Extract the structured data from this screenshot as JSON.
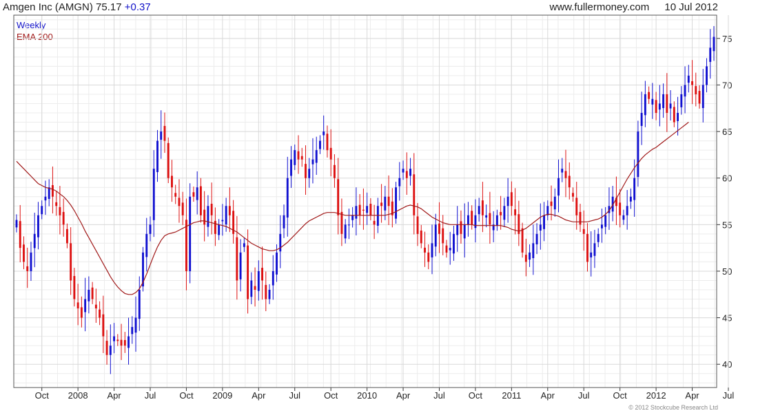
{
  "header": {
    "company": "Amgen Inc (AMGN)",
    "last": "75.17",
    "change": "+0.37",
    "site": "www.fullermoney.com",
    "date": "10 Jul 2012"
  },
  "footer": {
    "copyright": "© 2012 Stockcube Research Ltd"
  },
  "colors": {
    "up": "#1010d0",
    "down": "#dd1010",
    "ema": "#a01818",
    "grid": "#d8d8d8",
    "axis": "#333333"
  },
  "chart_data": {
    "type": "candlestick",
    "title": "Amgen Inc (AMGN)",
    "interval": "Weekly",
    "ylim": [
      37.5,
      77.5
    ],
    "y_ticks": [
      40,
      45,
      50,
      55,
      60,
      65,
      70,
      75
    ],
    "x_ticks": [
      {
        "label": "Oct",
        "week": 7
      },
      {
        "label": "2008",
        "week": 17
      },
      {
        "label": "Apr",
        "week": 27
      },
      {
        "label": "Jul",
        "week": 37
      },
      {
        "label": "Oct",
        "week": 47
      },
      {
        "label": "2009",
        "week": 57
      },
      {
        "label": "Apr",
        "week": 67
      },
      {
        "label": "Jul",
        "week": 77
      },
      {
        "label": "Oct",
        "week": 87
      },
      {
        "label": "2010",
        "week": 97
      },
      {
        "label": "Apr",
        "week": 107
      },
      {
        "label": "Jul",
        "week": 117
      },
      {
        "label": "Oct",
        "week": 127
      },
      {
        "label": "2011",
        "week": 137
      },
      {
        "label": "Apr",
        "week": 147
      },
      {
        "label": "Jul",
        "week": 157
      },
      {
        "label": "Oct",
        "week": 167
      },
      {
        "label": "2012",
        "week": 177
      },
      {
        "label": "Apr",
        "week": 187
      },
      {
        "label": "Jul",
        "week": 197
      }
    ],
    "legend": [
      "Weekly",
      "EMA 200"
    ],
    "closes": [
      55.5,
      52.5,
      51,
      50,
      52,
      54,
      56,
      57,
      58,
      59,
      58,
      57,
      56,
      55,
      53,
      49,
      47,
      46,
      45,
      47,
      48,
      47,
      46,
      45,
      43,
      41,
      42,
      43,
      42.5,
      42,
      42,
      43,
      44,
      45,
      48,
      52,
      54,
      55,
      61,
      64,
      65,
      64,
      60,
      59,
      58,
      57,
      56,
      50,
      58,
      58,
      59,
      56,
      55,
      57,
      56,
      54,
      55,
      55.5,
      57,
      56,
      54,
      49,
      52,
      53,
      47,
      49,
      48,
      50,
      49,
      47,
      48,
      50,
      52,
      54,
      56,
      60,
      62,
      63,
      62,
      62,
      60,
      61,
      62,
      63,
      64,
      65,
      63,
      62,
      60,
      56,
      54,
      55,
      55,
      56,
      57,
      56,
      56.5,
      57,
      56,
      55,
      57,
      57,
      58,
      57,
      56,
      59,
      60,
      61,
      60,
      61,
      56,
      54,
      53,
      52,
      51,
      53,
      55,
      54,
      53,
      52,
      52.5,
      54,
      55,
      54,
      55,
      56,
      55,
      56,
      57,
      56,
      56,
      55,
      55,
      56,
      56,
      57,
      58,
      57,
      56,
      54,
      52,
      51,
      52,
      53,
      54,
      55,
      56,
      57,
      57,
      58,
      60,
      61,
      60,
      59,
      58,
      56,
      55,
      54,
      51,
      52,
      53,
      54,
      55,
      56,
      57,
      58,
      57,
      56,
      56,
      57,
      58,
      60,
      65,
      67,
      69,
      68.5,
      68.5,
      67,
      68,
      69,
      67,
      68,
      66,
      67,
      69,
      70,
      71,
      70,
      69,
      68,
      70,
      72,
      74,
      75.17
    ],
    "ema_200": [
      61.8,
      61.4,
      61,
      60.6,
      60.2,
      59.8,
      59.4,
      59.2,
      59,
      58.9,
      58.8,
      58.6,
      58.3,
      58,
      57.6,
      57.1,
      56.5,
      55.8,
      55.1,
      54.3,
      53.6,
      52.9,
      52.2,
      51.5,
      50.8,
      50.1,
      49.4,
      48.8,
      48.3,
      47.9,
      47.6,
      47.5,
      47.5,
      47.7,
      48.1,
      48.8,
      49.7,
      50.7,
      51.7,
      52.6,
      53.3,
      53.8,
      54,
      54.1,
      54.2,
      54.4,
      54.6,
      54.8,
      55,
      55.2,
      55.3,
      55.4,
      55.4,
      55.3,
      55.2,
      55.1,
      55,
      54.9,
      54.8,
      54.6,
      54.4,
      54.2,
      53.9,
      53.6,
      53.3,
      53,
      52.8,
      52.6,
      52.4,
      52.3,
      52.2,
      52.2,
      52.3,
      52.5,
      52.8,
      53.1,
      53.5,
      53.9,
      54.3,
      54.7,
      55.1,
      55.4,
      55.6,
      55.8,
      56,
      56.2,
      56.3,
      56.3,
      56.3,
      56.2,
      56.1,
      56,
      56,
      56,
      56,
      56,
      56,
      56,
      56,
      56,
      56,
      56,
      56,
      56.1,
      56.2,
      56.4,
      56.6,
      56.8,
      57,
      57.1,
      57,
      56.9,
      56.7,
      56.4,
      56.1,
      55.8,
      55.6,
      55.4,
      55.2,
      55.1,
      55,
      55,
      55,
      55,
      55,
      55,
      55,
      54.9,
      54.9,
      54.9,
      54.9,
      54.9,
      54.9,
      54.9,
      54.9,
      54.8,
      54.7,
      54.5,
      54.4,
      54.3,
      54.4,
      54.6,
      54.9,
      55.2,
      55.5,
      55.8,
      56,
      56.1,
      56.1,
      56,
      55.9,
      55.7,
      55.5,
      55.4,
      55.3,
      55.3,
      55.3,
      55.3,
      55.3,
      55.4,
      55.5,
      55.6,
      55.8,
      56.1,
      56.5,
      57.1,
      57.8,
      58.5,
      59.2,
      59.9,
      60.5,
      61.1,
      61.6,
      62.1,
      62.5,
      62.8,
      63.1,
      63.3,
      63.6,
      63.9,
      64.2,
      64.5,
      64.8,
      65.1,
      65.4,
      65.7,
      66
    ]
  }
}
